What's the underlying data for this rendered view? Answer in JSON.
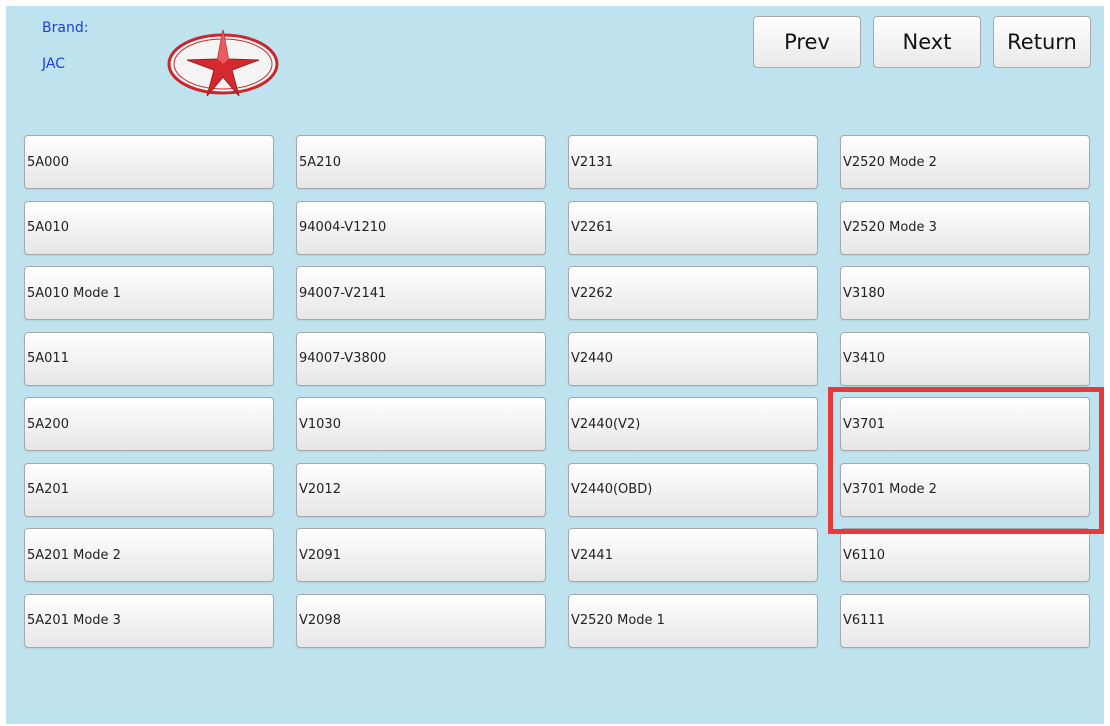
{
  "brand": {
    "label": "Brand:",
    "name": "JAC",
    "logo_icon": "jac-star-logo",
    "logo_color": "#c8282d"
  },
  "nav": {
    "prev": "Prev",
    "next": "Next",
    "return": "Return"
  },
  "models": [
    "5A000",
    "5A210",
    "V2131",
    "V2520 Mode 2",
    "5A010",
    "94004-V1210",
    "V2261",
    "V2520 Mode 3",
    "5A010 Mode 1",
    "94007-V2141",
    "V2262",
    "V3180",
    "5A011",
    "94007-V3800",
    "V2440",
    "V3410",
    "5A200",
    "V1030",
    "V2440(V2)",
    "V3701",
    "5A201",
    "V2012",
    "V2440(OBD)",
    "V3701 Mode 2",
    "5A201 Mode 2",
    "V2091",
    "V2441",
    "V6110",
    "5A201 Mode 3",
    "V2098",
    "V2520 Mode 1",
    "V6111"
  ],
  "colors": {
    "background": "#bfe3ee",
    "brand_text": "#1c3fe0",
    "highlight": "#e83a3a"
  }
}
